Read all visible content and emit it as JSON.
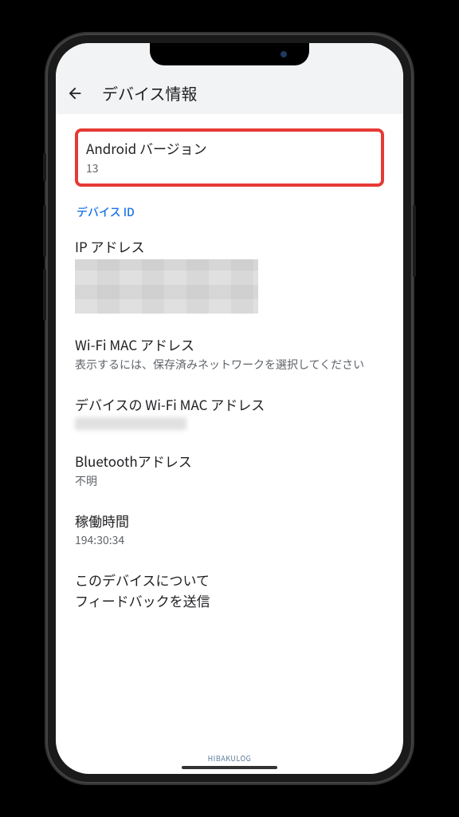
{
  "header": {
    "title": "デバイス情報"
  },
  "items": {
    "android_version": {
      "title": "Android バージョン",
      "value": "13"
    },
    "device_id_link": "デバイス ID",
    "ip_address": {
      "title": "IP アドレス"
    },
    "wifi_mac": {
      "title": "Wi-Fi MAC アドレス",
      "sub": "表示するには、保存済みネットワークを選択してください"
    },
    "device_wifi_mac": {
      "title": "デバイスの Wi-Fi MAC アドレス"
    },
    "bluetooth": {
      "title": "Bluetoothアドレス",
      "sub": "不明"
    },
    "uptime": {
      "title": "稼働時間",
      "sub": "194:30:34"
    },
    "feedback": {
      "line1": "このデバイスについて",
      "line2": "フィードバックを送信"
    }
  },
  "watermark": "HIBAKULOG"
}
